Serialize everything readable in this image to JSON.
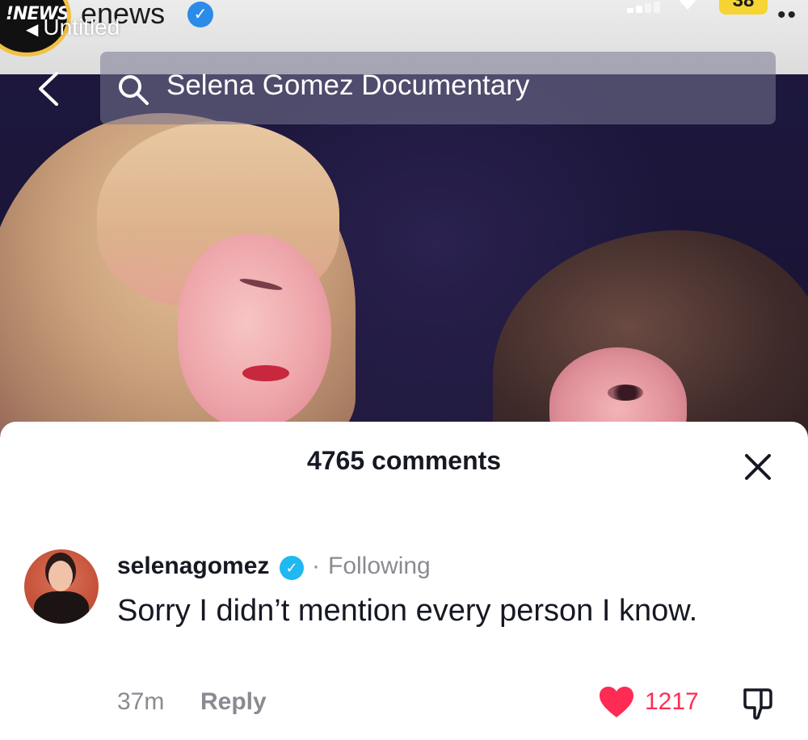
{
  "status_bar": {
    "account_name": "enews",
    "avatar_badge": "!NEWS",
    "back_app_label": "Untitled",
    "battery_level": "38",
    "more_dots": "••",
    "verified": true
  },
  "search": {
    "query": "Selena Gomez Documentary",
    "icon": "search-icon"
  },
  "comments_sheet": {
    "title": "4765 comments",
    "close_icon": "close-icon",
    "comments": [
      {
        "username": "selenagomez",
        "verified": true,
        "separator": "·",
        "relation": "Following",
        "text": "Sorry I didn’t mention every person I know.",
        "time": "37m",
        "reply_label": "Reply",
        "likes": "1217",
        "liked": true
      }
    ]
  },
  "colors": {
    "accent_like": "#fe2c55",
    "verified_blue": "#20b8f0",
    "battery_yellow": "#f5d433",
    "text_primary": "#161823",
    "text_secondary": "#8a8b91"
  }
}
